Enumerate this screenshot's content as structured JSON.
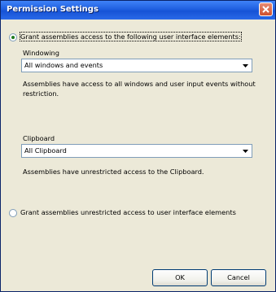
{
  "window": {
    "title": "Permission Settings"
  },
  "options": {
    "restricted_label": "Grant assemblies access to the following user interface elements:",
    "unrestricted_label": "Grant assemblies unrestricted access to user interface elements"
  },
  "windowing": {
    "label": "Windowing",
    "selected": "All windows and events",
    "description": "Assemblies have access to all windows and user input events without restriction."
  },
  "clipboard": {
    "label": "Clipboard",
    "selected": "All Clipboard",
    "description": "Assemblies have unrestricted access to the Clipboard."
  },
  "buttons": {
    "ok": "OK",
    "cancel": "Cancel"
  },
  "colors": {
    "titlebar": "#1f5fe0",
    "dialog_bg": "#ece9d8",
    "close": "#d0502e"
  }
}
